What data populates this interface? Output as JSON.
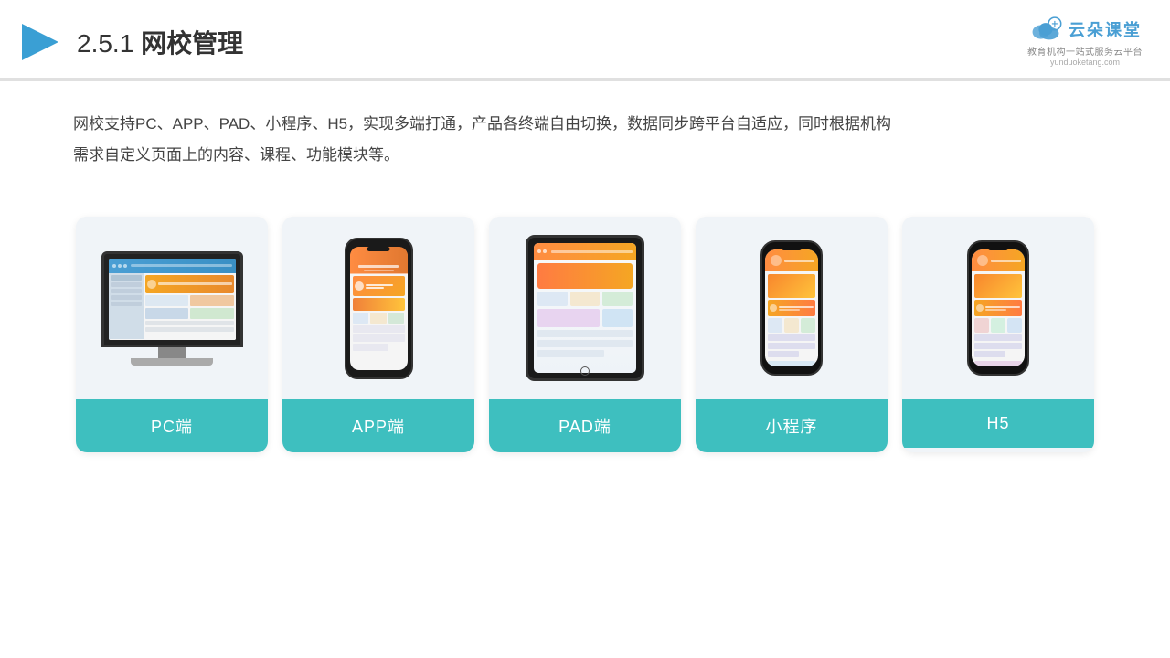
{
  "header": {
    "title": "网校管理",
    "title_prefix": "2.5.1",
    "logo_text": "云朵课堂",
    "logo_url": "yunduoketang.com",
    "logo_sub": "教育机构一站\n式服务云平台"
  },
  "description": {
    "line1": "网校支持PC、APP、PAD、小程序、H5，实现多端打通，产品各终端自由切换，数据同步跨平台自适应，同时根据机构",
    "line2": "需求自定义页面上的内容、课程、功能模块等。"
  },
  "cards": [
    {
      "id": "pc",
      "label": "PC端"
    },
    {
      "id": "app",
      "label": "APP端"
    },
    {
      "id": "pad",
      "label": "PAD端"
    },
    {
      "id": "miniprogram",
      "label": "小程序"
    },
    {
      "id": "h5",
      "label": "H5"
    }
  ]
}
